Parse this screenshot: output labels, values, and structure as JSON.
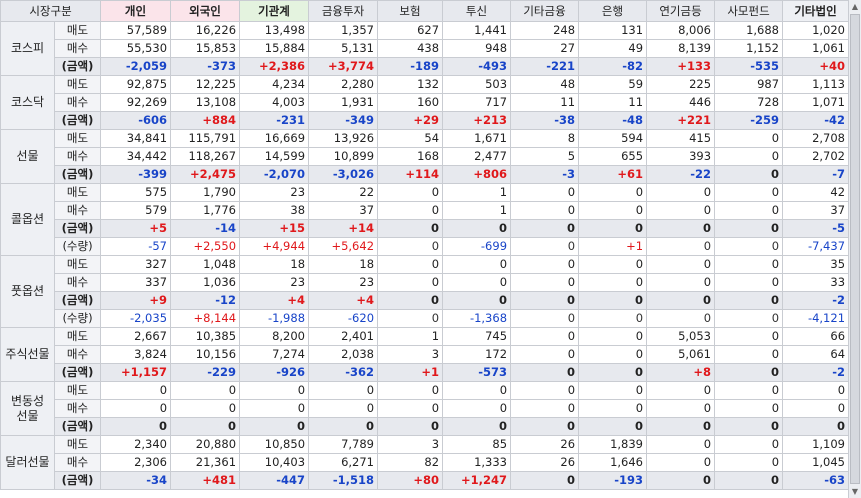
{
  "headers": [
    "시장구분",
    "개인",
    "외국인",
    "기관계",
    "금융투자",
    "보험",
    "투신",
    "기타금융",
    "은행",
    "연기금등",
    "사모펀드",
    "기타법인"
  ],
  "header_colors": {
    "individual": "#fbe4ea",
    "foreign": "#fbe4ea",
    "institution": "#e4f3df"
  },
  "value_colors": {
    "positive": "#e0181b",
    "negative": "#1844c8"
  },
  "markets": [
    {
      "name": "코스피",
      "rows": [
        {
          "label": "매도",
          "type": "sell",
          "values": [
            "57,589",
            "16,226",
            "13,498",
            "1,357",
            "627",
            "1,441",
            "248",
            "131",
            "8,006",
            "1,688",
            "1,020"
          ]
        },
        {
          "label": "매수",
          "type": "buy",
          "values": [
            "55,530",
            "15,853",
            "15,884",
            "5,131",
            "438",
            "948",
            "27",
            "49",
            "8,139",
            "1,152",
            "1,061"
          ]
        },
        {
          "label": "(금액)",
          "type": "amt",
          "values": [
            "-2,059",
            "-373",
            "+2,386",
            "+3,774",
            "-189",
            "-493",
            "-221",
            "-82",
            "+133",
            "-535",
            "+40"
          ]
        }
      ]
    },
    {
      "name": "코스닥",
      "rows": [
        {
          "label": "매도",
          "type": "sell",
          "values": [
            "92,875",
            "12,225",
            "4,234",
            "2,280",
            "132",
            "503",
            "48",
            "59",
            "225",
            "987",
            "1,113"
          ]
        },
        {
          "label": "매수",
          "type": "buy",
          "values": [
            "92,269",
            "13,108",
            "4,003",
            "1,931",
            "160",
            "717",
            "11",
            "11",
            "446",
            "728",
            "1,071"
          ]
        },
        {
          "label": "(금액)",
          "type": "amt",
          "values": [
            "-606",
            "+884",
            "-231",
            "-349",
            "+29",
            "+213",
            "-38",
            "-48",
            "+221",
            "-259",
            "-42"
          ]
        }
      ]
    },
    {
      "name": "선물",
      "rows": [
        {
          "label": "매도",
          "type": "sell",
          "values": [
            "34,841",
            "115,791",
            "16,669",
            "13,926",
            "54",
            "1,671",
            "8",
            "594",
            "415",
            "0",
            "2,708"
          ]
        },
        {
          "label": "매수",
          "type": "buy",
          "values": [
            "34,442",
            "118,267",
            "14,599",
            "10,899",
            "168",
            "2,477",
            "5",
            "655",
            "393",
            "0",
            "2,702"
          ]
        },
        {
          "label": "(금액)",
          "type": "amt",
          "values": [
            "-399",
            "+2,475",
            "-2,070",
            "-3,026",
            "+114",
            "+806",
            "-3",
            "+61",
            "-22",
            "0",
            "-7"
          ]
        }
      ]
    },
    {
      "name": "콜옵션",
      "rows": [
        {
          "label": "매도",
          "type": "sell",
          "values": [
            "575",
            "1,790",
            "23",
            "22",
            "0",
            "1",
            "0",
            "0",
            "0",
            "0",
            "42"
          ]
        },
        {
          "label": "매수",
          "type": "buy",
          "values": [
            "579",
            "1,776",
            "38",
            "37",
            "0",
            "1",
            "0",
            "0",
            "0",
            "0",
            "37"
          ]
        },
        {
          "label": "(금액)",
          "type": "amt",
          "values": [
            "+5",
            "-14",
            "+15",
            "+14",
            "0",
            "0",
            "0",
            "0",
            "0",
            "0",
            "-5"
          ]
        },
        {
          "label": "(수량)",
          "type": "qty",
          "values": [
            "-57",
            "+2,550",
            "+4,944",
            "+5,642",
            "0",
            "-699",
            "0",
            "+1",
            "0",
            "0",
            "-7,437"
          ]
        }
      ]
    },
    {
      "name": "풋옵션",
      "rows": [
        {
          "label": "매도",
          "type": "sell",
          "values": [
            "327",
            "1,048",
            "18",
            "18",
            "0",
            "0",
            "0",
            "0",
            "0",
            "0",
            "35"
          ]
        },
        {
          "label": "매수",
          "type": "buy",
          "values": [
            "337",
            "1,036",
            "23",
            "23",
            "0",
            "0",
            "0",
            "0",
            "0",
            "0",
            "33"
          ]
        },
        {
          "label": "(금액)",
          "type": "amt",
          "values": [
            "+9",
            "-12",
            "+4",
            "+4",
            "0",
            "0",
            "0",
            "0",
            "0",
            "0",
            "-2"
          ]
        },
        {
          "label": "(수량)",
          "type": "qty",
          "values": [
            "-2,035",
            "+8,144",
            "-1,988",
            "-620",
            "0",
            "-1,368",
            "0",
            "0",
            "0",
            "0",
            "-4,121"
          ]
        }
      ]
    },
    {
      "name": "주식선물",
      "rows": [
        {
          "label": "매도",
          "type": "sell",
          "values": [
            "2,667",
            "10,385",
            "8,200",
            "2,401",
            "1",
            "745",
            "0",
            "0",
            "5,053",
            "0",
            "66"
          ]
        },
        {
          "label": "매수",
          "type": "buy",
          "values": [
            "3,824",
            "10,156",
            "7,274",
            "2,038",
            "3",
            "172",
            "0",
            "0",
            "5,061",
            "0",
            "64"
          ]
        },
        {
          "label": "(금액)",
          "type": "amt",
          "values": [
            "+1,157",
            "-229",
            "-926",
            "-362",
            "+1",
            "-573",
            "0",
            "0",
            "+8",
            "0",
            "-2"
          ]
        }
      ]
    },
    {
      "name": "변동성\n선물",
      "rows": [
        {
          "label": "매도",
          "type": "sell",
          "values": [
            "0",
            "0",
            "0",
            "0",
            "0",
            "0",
            "0",
            "0",
            "0",
            "0",
            "0"
          ]
        },
        {
          "label": "매수",
          "type": "buy",
          "values": [
            "0",
            "0",
            "0",
            "0",
            "0",
            "0",
            "0",
            "0",
            "0",
            "0",
            "0"
          ]
        },
        {
          "label": "(금액)",
          "type": "amt",
          "values": [
            "0",
            "0",
            "0",
            "0",
            "0",
            "0",
            "0",
            "0",
            "0",
            "0",
            "0"
          ]
        }
      ]
    },
    {
      "name": "달러선물",
      "rows": [
        {
          "label": "매도",
          "type": "sell",
          "values": [
            "2,340",
            "20,880",
            "10,850",
            "7,789",
            "3",
            "85",
            "26",
            "1,839",
            "0",
            "0",
            "1,109"
          ]
        },
        {
          "label": "매수",
          "type": "buy",
          "values": [
            "2,306",
            "21,361",
            "10,403",
            "6,271",
            "82",
            "1,333",
            "26",
            "1,646",
            "0",
            "0",
            "1,045"
          ]
        },
        {
          "label": "(금액)",
          "type": "amt",
          "values": [
            "-34",
            "+481",
            "-447",
            "-1,518",
            "+80",
            "+1,247",
            "0",
            "-193",
            "0",
            "0",
            "-63"
          ]
        }
      ]
    }
  ],
  "scrollbar": {
    "up_icon": "arrow-up-icon",
    "down_icon": "arrow-down-icon"
  }
}
